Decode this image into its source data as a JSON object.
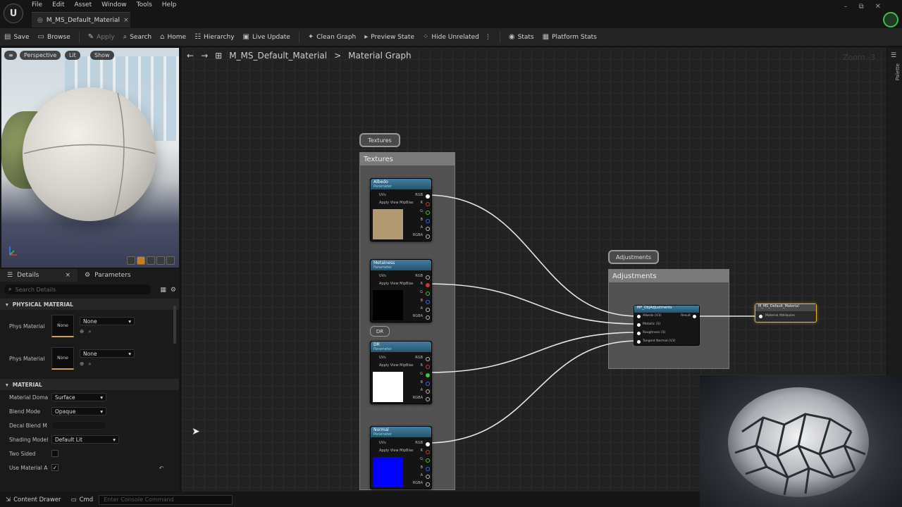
{
  "app": {
    "logo": "U",
    "menu": [
      "File",
      "Edit",
      "Asset",
      "Window",
      "Tools",
      "Help"
    ],
    "tab_title": "M_MS_Default_Material",
    "tab_close": "×",
    "window_controls": [
      "–",
      "⧉",
      "✕"
    ]
  },
  "toolbar": {
    "items": [
      {
        "label": "Save",
        "icon": "save-icon",
        "enabled": true
      },
      {
        "label": "Browse",
        "icon": "folder-icon",
        "enabled": true
      },
      {
        "label": "Apply",
        "icon": "apply-icon",
        "enabled": false
      },
      {
        "label": "Search",
        "icon": "search-icon",
        "enabled": true
      },
      {
        "label": "Home",
        "icon": "home-icon",
        "enabled": true
      },
      {
        "label": "Hierarchy",
        "icon": "hierarchy-icon",
        "enabled": true
      },
      {
        "label": "Live Update",
        "icon": "live-update-icon",
        "enabled": true
      },
      {
        "label": "Clean Graph",
        "icon": "clean-graph-icon",
        "enabled": true
      },
      {
        "label": "Preview State",
        "icon": "preview-state-icon",
        "enabled": true
      },
      {
        "label": "Hide Unrelated",
        "icon": "hide-unrelated-icon",
        "enabled": true
      },
      {
        "label": "Stats",
        "icon": "stats-icon",
        "enabled": true
      },
      {
        "label": "Platform Stats",
        "icon": "platform-stats-icon",
        "enabled": true
      }
    ]
  },
  "viewport": {
    "perspective": "Perspective",
    "lit": "Lit",
    "show": "Show"
  },
  "details": {
    "tab_details": "Details",
    "tab_parameters": "Parameters",
    "search_placeholder": "Search Details",
    "section_physical": "PHYSICAL MATERIAL",
    "phys1_label": "Phys Material",
    "phys1_thumb": "None",
    "phys1_value": "None",
    "phys2_label": "Phys Material",
    "phys2_thumb": "None",
    "phys2_value": "None",
    "section_material": "MATERIAL",
    "domain_label": "Material Doma",
    "domain_value": "Surface",
    "blend_label": "Blend Mode",
    "blend_value": "Opaque",
    "decal_label": "Decal Blend M",
    "shading_label": "Shading Model",
    "shading_value": "Default Lit",
    "twosided_label": "Two Sided",
    "usematattr_label": "Use Material A",
    "usematattr_checked": "✓"
  },
  "graph": {
    "breadcrumb_asset": "M_MS_Default_Material",
    "breadcrumb_sep": ">",
    "breadcrumb_graph": "Material Graph",
    "zoom": "Zoom -3",
    "palette_label": "Palette",
    "textures_bubble": "Textures",
    "textures_comment": "Textures",
    "adjustments_bubble": "Adjustments",
    "adjustments_comment": "Adjustments",
    "dr_badge": "DR",
    "texture_nodes": [
      {
        "title": "Albedo",
        "sub": "Parameter",
        "uvs": "UVs",
        "mip": "Apply View MipBias",
        "out_rgb": "RGB",
        "r": "R",
        "g": "G",
        "b": "B",
        "a": "A",
        "rgba": "RGBA"
      },
      {
        "title": "Metalness",
        "sub": "Parameter",
        "uvs": "UVs",
        "mip": "Apply View MipBias",
        "out_rgb": "RGB",
        "r": "R",
        "g": "G",
        "b": "B",
        "a": "A",
        "rgba": "RGBA"
      },
      {
        "title": "DR",
        "sub": "Parameter",
        "uvs": "UVs",
        "mip": "Apply View MipBias",
        "out_rgb": "RGB",
        "r": "R",
        "g": "G",
        "b": "B",
        "a": "A",
        "rgba": "RGBA"
      },
      {
        "title": "Normal",
        "sub": "Parameter",
        "uvs": "UVs",
        "mip": "Apply View MipBias",
        "out_rgb": "RGB",
        "r": "R",
        "g": "G",
        "b": "B",
        "a": "A",
        "rgba": "RGBA"
      }
    ],
    "function_node": {
      "title": "MF_ObjAdjustments",
      "inputs": [
        "Albedo (V3)",
        "Metallic (S)",
        "Roughness (S)",
        "Tangent Normal (V3)"
      ],
      "output": "Result"
    },
    "output_node": {
      "title": "M_MS_Default_Material",
      "input": "Material Attributes"
    }
  },
  "statusbar": {
    "content_drawer": "Content Drawer",
    "cmd": "Cmd",
    "console_placeholder": "Enter Console Command"
  },
  "colors": {
    "accent_orange": "#e8b03b",
    "node_header": "#2f6a8a",
    "albedo_swatch": "#b49a73",
    "metal_swatch": "#000000",
    "dr_swatch": "#ffffff",
    "normal_swatch": "#0000ff"
  }
}
